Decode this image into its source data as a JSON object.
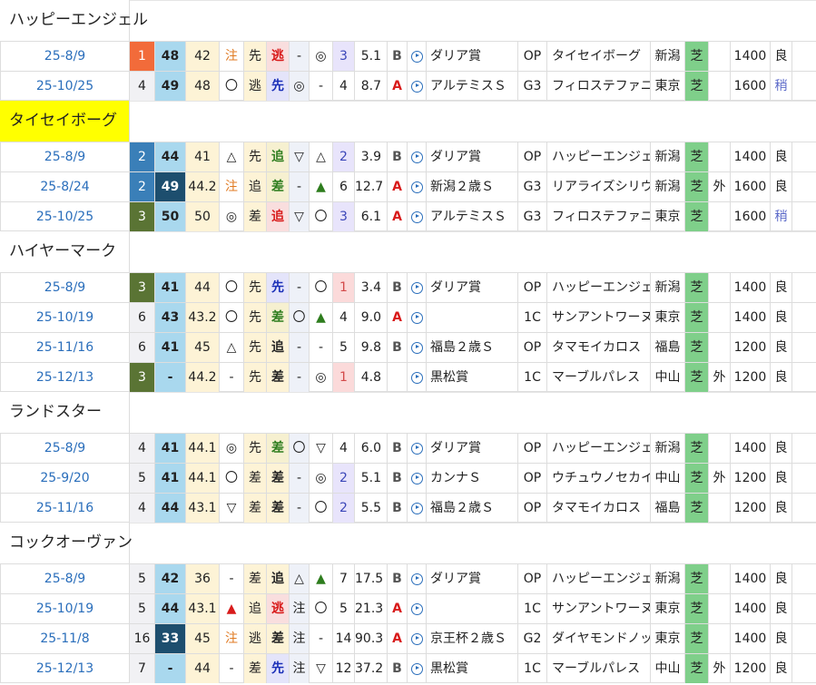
{
  "colors": {
    "rank_1": "#f26b3a",
    "rank_2": "#3a7fb8",
    "rank_3": "#5a7434",
    "speed_bg": "#a9d8ee",
    "speed_dark": "#1d4e6e",
    "surface_turf": "#7fcf8a",
    "highlight_name": "#ffff00",
    "date_link": "#2a6ebb"
  },
  "horses": [
    {
      "name": "ハッピーエンジェル",
      "highlight": false,
      "races": [
        {
          "date": "25-8/9",
          "rank": "1",
          "s1": "48",
          "s2": "42",
          "m1": "注",
          "st1": "先",
          "st2": "逃",
          "st2c": "red",
          "m2": "-",
          "m3": "◎",
          "pop": "3",
          "odds": "5.1",
          "dir": "B",
          "race": "ダリア賞",
          "grade": "OP",
          "winner": "タイセイボーグ",
          "place": "新潟",
          "surface": "芝",
          "side": "",
          "dist": "1400",
          "cond": "良"
        },
        {
          "date": "25-10/25",
          "rank": "4",
          "s1": "49",
          "s2": "48",
          "m1": "〇",
          "st1": "逃",
          "st2": "先",
          "st2c": "blue",
          "m2": "◎",
          "m3": "-",
          "pop": "4",
          "odds": "8.7",
          "dir": "A",
          "race": "アルテミスＳ",
          "grade": "G3",
          "winner": "フィロステファニ",
          "place": "東京",
          "surface": "芝",
          "side": "",
          "dist": "1600",
          "cond": "稍"
        }
      ]
    },
    {
      "name": "タイセイボーグ",
      "highlight": true,
      "races": [
        {
          "date": "25-8/9",
          "rank": "2",
          "s1": "44",
          "s2": "41",
          "m1": "△",
          "st1": "先",
          "st2": "追",
          "st2c": "green",
          "m2": "▽",
          "m3": "△",
          "pop": "2",
          "odds": "3.9",
          "dir": "B",
          "race": "ダリア賞",
          "grade": "OP",
          "winner": "ハッピーエンジェル",
          "place": "新潟",
          "surface": "芝",
          "side": "",
          "dist": "1400",
          "cond": "良"
        },
        {
          "date": "25-8/24",
          "rank": "2",
          "s1": "49",
          "s1dark": true,
          "s2": "44.2",
          "m1": "注",
          "st1": "追",
          "st2": "差",
          "st2c": "green",
          "m2": "-",
          "m3": "▲",
          "pop": "6",
          "odds": "12.7",
          "dir": "A",
          "race": "新潟２歳Ｓ",
          "grade": "G3",
          "winner": "リアライズシリウス",
          "place": "新潟",
          "surface": "芝",
          "side": "外",
          "dist": "1600",
          "cond": "良"
        },
        {
          "date": "25-10/25",
          "rank": "3",
          "s1": "50",
          "s2": "50",
          "m1": "◎",
          "st1": "差",
          "st2": "追",
          "st2c": "red",
          "m2": "▽",
          "m3": "〇",
          "pop": "3",
          "odds": "6.1",
          "dir": "A",
          "race": "アルテミスＳ",
          "grade": "G3",
          "winner": "フィロステファニ",
          "place": "東京",
          "surface": "芝",
          "side": "",
          "dist": "1600",
          "cond": "稍"
        }
      ]
    },
    {
      "name": "ハイヤーマーク",
      "highlight": false,
      "races": [
        {
          "date": "25-8/9",
          "rank": "3",
          "s1": "41",
          "s2": "44",
          "m1": "〇",
          "st1": "先",
          "st2": "先",
          "st2c": "blue",
          "m2": "-",
          "m3": "〇",
          "pop": "1",
          "odds": "3.4",
          "dir": "B",
          "race": "ダリア賞",
          "grade": "OP",
          "winner": "ハッピーエンジェル",
          "place": "新潟",
          "surface": "芝",
          "side": "",
          "dist": "1400",
          "cond": "良"
        },
        {
          "date": "25-10/19",
          "rank": "6",
          "s1": "43",
          "s2": "43.2",
          "m1": "〇",
          "st1": "先",
          "st2": "差",
          "st2c": "green",
          "m2": "〇",
          "m3": "▲",
          "pop": "4",
          "odds": "9.0",
          "dir": "A",
          "race": "",
          "grade": "1C",
          "winner": "サンアントワーヌ",
          "place": "東京",
          "surface": "芝",
          "side": "",
          "dist": "1400",
          "cond": "良"
        },
        {
          "date": "25-11/16",
          "rank": "6",
          "s1": "41",
          "s2": "45",
          "m1": "△",
          "st1": "先",
          "st2": "追",
          "st2c": "plain",
          "m2": "-",
          "m3": "-",
          "pop": "5",
          "odds": "9.8",
          "dir": "B",
          "race": "福島２歳Ｓ",
          "grade": "OP",
          "winner": "タマモイカロス",
          "place": "福島",
          "surface": "芝",
          "side": "",
          "dist": "1200",
          "cond": "良"
        },
        {
          "date": "25-12/13",
          "rank": "3",
          "s1": "-",
          "s2": "44.2",
          "m1": "-",
          "st1": "先",
          "st2": "差",
          "st2c": "plain",
          "m2": "-",
          "m3": "◎",
          "pop": "1",
          "odds": "4.8",
          "dir": "",
          "race": "黒松賞",
          "grade": "1C",
          "winner": "マーブルパレス",
          "place": "中山",
          "surface": "芝",
          "side": "外",
          "dist": "1200",
          "cond": "良"
        }
      ]
    },
    {
      "name": "ランドスター",
      "highlight": false,
      "races": [
        {
          "date": "25-8/9",
          "rank": "4",
          "s1": "41",
          "s2": "44.1",
          "m1": "◎",
          "st1": "先",
          "st2": "差",
          "st2c": "green",
          "m2": "〇",
          "m3": "▽",
          "pop": "4",
          "odds": "6.0",
          "dir": "B",
          "race": "ダリア賞",
          "grade": "OP",
          "winner": "ハッピーエンジェル",
          "place": "新潟",
          "surface": "芝",
          "side": "",
          "dist": "1400",
          "cond": "良"
        },
        {
          "date": "25-9/20",
          "rank": "5",
          "s1": "41",
          "s2": "44.1",
          "m1": "〇",
          "st1": "差",
          "st2": "差",
          "st2c": "plain",
          "m2": "-",
          "m3": "◎",
          "pop": "2",
          "odds": "5.1",
          "dir": "B",
          "race": "カンナＳ",
          "grade": "OP",
          "winner": "ウチュウノセカイ",
          "place": "中山",
          "surface": "芝",
          "side": "外",
          "dist": "1200",
          "cond": "良"
        },
        {
          "date": "25-11/16",
          "rank": "4",
          "s1": "44",
          "s2": "43.1",
          "m1": "▽",
          "st1": "差",
          "st2": "差",
          "st2c": "plain",
          "m2": "-",
          "m3": "〇",
          "pop": "2",
          "odds": "5.5",
          "dir": "B",
          "race": "福島２歳Ｓ",
          "grade": "OP",
          "winner": "タマモイカロス",
          "place": "福島",
          "surface": "芝",
          "side": "",
          "dist": "1200",
          "cond": "良"
        }
      ]
    },
    {
      "name": "コックオーヴァン",
      "highlight": false,
      "races": [
        {
          "date": "25-8/9",
          "rank": "5",
          "s1": "42",
          "s2": "36",
          "m1": "-",
          "st1": "差",
          "st2": "追",
          "st2c": "plain",
          "m2": "△",
          "m3": "▲",
          "pop": "7",
          "odds": "17.5",
          "dir": "B",
          "race": "ダリア賞",
          "grade": "OP",
          "winner": "ハッピーエンジェル",
          "place": "新潟",
          "surface": "芝",
          "side": "",
          "dist": "1400",
          "cond": "良"
        },
        {
          "date": "25-10/19",
          "rank": "5",
          "s1": "44",
          "s2": "43.1",
          "m1": "▲",
          "st1": "追",
          "st2": "逃",
          "st2c": "red",
          "m2": "注",
          "m3": "〇",
          "pop": "5",
          "odds": "21.3",
          "dir": "A",
          "race": "",
          "grade": "1C",
          "winner": "サンアントワーヌ",
          "place": "東京",
          "surface": "芝",
          "side": "",
          "dist": "1400",
          "cond": "良"
        },
        {
          "date": "25-11/8",
          "rank": "16",
          "s1": "33",
          "s1dark": true,
          "s2": "45",
          "m1": "注",
          "st1": "逃",
          "st2": "差",
          "st2c": "plain",
          "m2": "注",
          "m3": "-",
          "pop": "14",
          "odds": "90.3",
          "dir": "A",
          "race": "京王杯２歳Ｓ",
          "grade": "G2",
          "winner": "ダイヤモンドノット",
          "place": "東京",
          "surface": "芝",
          "side": "",
          "dist": "1400",
          "cond": "良"
        },
        {
          "date": "25-12/13",
          "rank": "7",
          "s1": "-",
          "s2": "44",
          "m1": "-",
          "st1": "差",
          "st2": "先",
          "st2c": "blue",
          "m2": "注",
          "m3": "▽",
          "pop": "12",
          "odds": "37.2",
          "dir": "B",
          "race": "黒松賞",
          "grade": "1C",
          "winner": "マーブルパレス",
          "place": "中山",
          "surface": "芝",
          "side": "外",
          "dist": "1200",
          "cond": "良"
        }
      ]
    }
  ]
}
